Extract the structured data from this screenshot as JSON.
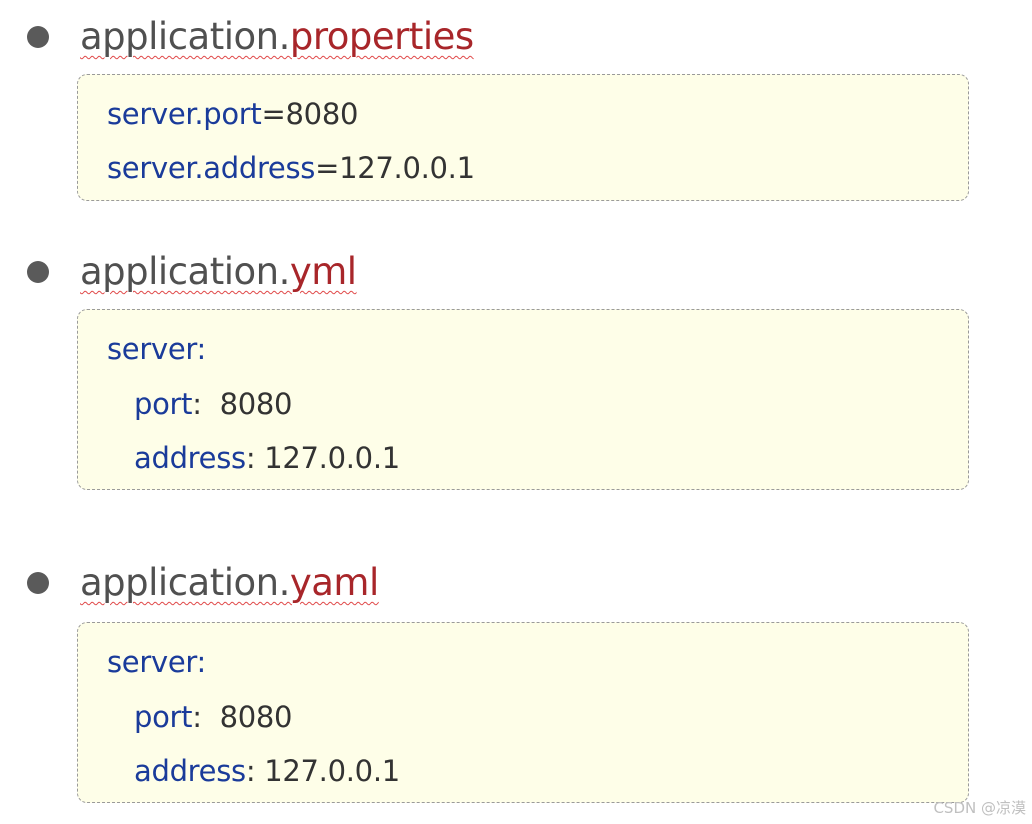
{
  "sections": [
    {
      "file_base": "application.",
      "file_ext": "properties",
      "lines": [
        {
          "key": "server.port",
          "sep": "=",
          "value": "8080"
        },
        {
          "key": "server.address",
          "sep": "=",
          "value": "127.0.0.1"
        }
      ]
    },
    {
      "file_base": "application.",
      "file_ext": "yml",
      "lines": [
        {
          "key": "server:",
          "sep": "",
          "value": ""
        },
        {
          "key": "port",
          "sep": ":  ",
          "value": "8080"
        },
        {
          "key": "address",
          "sep": ": ",
          "value": "127.0.0.1"
        }
      ]
    },
    {
      "file_base": "application.",
      "file_ext": "yaml",
      "lines": [
        {
          "key": "server:",
          "sep": "",
          "value": ""
        },
        {
          "key": "port",
          "sep": ":  ",
          "value": "8080"
        },
        {
          "key": "address",
          "sep": ": ",
          "value": "127.0.0.1"
        }
      ]
    }
  ],
  "watermark": "CSDN @凉漠"
}
